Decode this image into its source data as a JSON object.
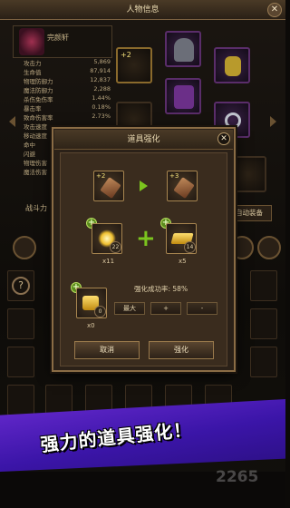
{
  "window": {
    "title": "人物信息",
    "close_label": "✕"
  },
  "character": {
    "name": "完颜轩"
  },
  "stats": [
    {
      "label": "攻击力",
      "value": "5,869"
    },
    {
      "label": "生命值",
      "value": "87,914"
    },
    {
      "label": "物理防御力",
      "value": "12,837"
    },
    {
      "label": "魔法防御力",
      "value": "2,288"
    },
    {
      "label": "杀伤免伤率",
      "value": "1.44%"
    },
    {
      "label": "暴击率",
      "value": "0.18%"
    },
    {
      "label": "致命伤害率",
      "value": "2.73%"
    },
    {
      "label": "攻击速度",
      "value": ""
    },
    {
      "label": "移动速度",
      "value": ""
    },
    {
      "label": "命中",
      "value": ""
    },
    {
      "label": "闪避",
      "value": ""
    },
    {
      "label": "物理伤害",
      "value": ""
    },
    {
      "label": "魔法伤害",
      "value": ""
    }
  ],
  "equip_slots": {
    "weapon_level": "+2"
  },
  "battle_power_label": "战斗力",
  "auto_equip_label": "自动装备",
  "dialog": {
    "title": "道具强化",
    "close_label": "✕",
    "from_level": "+2",
    "to_level": "+3",
    "material1": {
      "badge": "22",
      "count": "x11"
    },
    "material2": {
      "badge": "14",
      "count": "x5"
    },
    "catalyst": {
      "badge": "0",
      "count": "x0"
    },
    "success_rate": "强化成功率: 58%",
    "buttons": {
      "max": "最大",
      "plus": "+",
      "minus": "-",
      "cancel": "取消",
      "enhance": "强化"
    }
  },
  "banner": {
    "text": "强力的道具强化！",
    "watermark": "2265"
  },
  "colors": {
    "accent_green": "#7bc41e",
    "banner_purple": "#5a24c4",
    "frame_gold": "#8a6c45"
  }
}
